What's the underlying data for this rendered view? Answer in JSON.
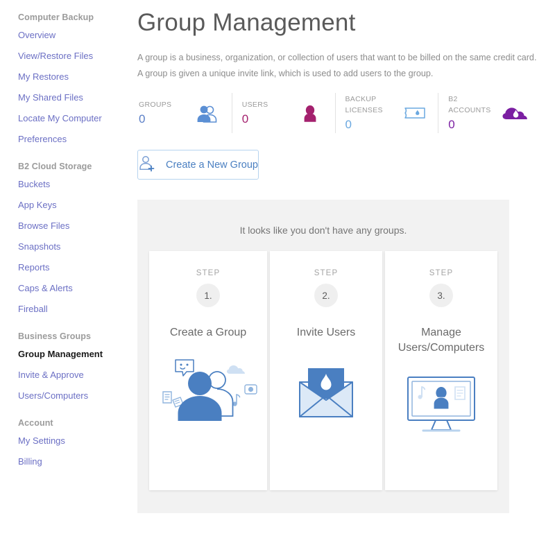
{
  "sidebar": {
    "groups": [
      {
        "heading": "Computer Backup",
        "items": [
          {
            "label": "Overview",
            "active": false
          },
          {
            "label": "View/Restore Files",
            "active": false
          },
          {
            "label": "My Restores",
            "active": false
          },
          {
            "label": "My Shared Files",
            "active": false
          },
          {
            "label": "Locate My Computer",
            "active": false
          },
          {
            "label": "Preferences",
            "active": false
          }
        ]
      },
      {
        "heading": "B2 Cloud Storage",
        "items": [
          {
            "label": "Buckets",
            "active": false
          },
          {
            "label": "App Keys",
            "active": false
          },
          {
            "label": "Browse Files",
            "active": false
          },
          {
            "label": "Snapshots",
            "active": false
          },
          {
            "label": "Reports",
            "active": false
          },
          {
            "label": "Caps & Alerts",
            "active": false
          },
          {
            "label": "Fireball",
            "active": false
          }
        ]
      },
      {
        "heading": "Business Groups",
        "items": [
          {
            "label": "Group Management",
            "active": true
          },
          {
            "label": "Invite & Approve",
            "active": false
          },
          {
            "label": "Users/Computers",
            "active": false
          }
        ]
      },
      {
        "heading": "Account",
        "items": [
          {
            "label": "My Settings",
            "active": false
          },
          {
            "label": "Billing",
            "active": false
          }
        ]
      }
    ]
  },
  "main": {
    "title": "Group Management",
    "description": "A group is a business, organization, or collection of users that want to be billed on the same credit card. A group is given a unique invite link, which is used to add users to the group.",
    "stats": [
      {
        "label": "GROUPS",
        "value": "0",
        "value_color": "#5b7fc7",
        "icon": "two-people-icon"
      },
      {
        "label": "USERS",
        "value": "0",
        "value_color": "#a4216e",
        "icon": "person-icon"
      },
      {
        "label": "BACKUP LICENSES",
        "value": "0",
        "value_color": "#6aa8e0",
        "icon": "license-ticket-icon"
      },
      {
        "label": "B2 ACCOUNTS",
        "value": "0",
        "value_color": "#7b1fa2",
        "icon": "cloud-flame-icon"
      }
    ],
    "create_button": {
      "label": "Create a New Group",
      "icon": "add-user-icon"
    },
    "empty_message": "It looks like you don't have any groups.",
    "steps": [
      {
        "step_word": "STEP",
        "number": "1.",
        "title": "Create a Group",
        "art": "people-media-illustration"
      },
      {
        "step_word": "STEP",
        "number": "2.",
        "title": "Invite Users",
        "art": "envelope-flame-illustration"
      },
      {
        "step_word": "STEP",
        "number": "3.",
        "title": "Manage\nUsers/Computers",
        "art": "monitor-person-illustration"
      }
    ]
  },
  "colors": {
    "accent_blue": "#4a7fc1",
    "link": "#6b6fc4",
    "panel_bg": "#f2f2f2"
  }
}
